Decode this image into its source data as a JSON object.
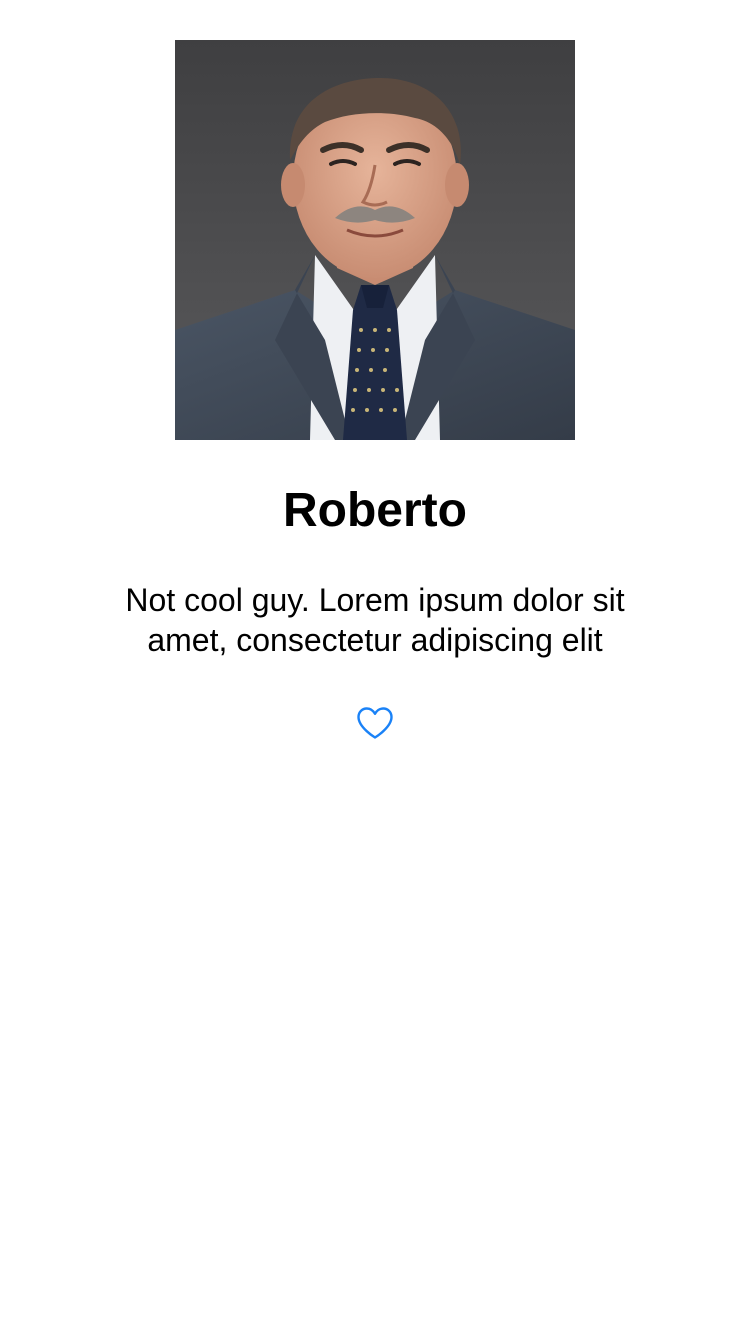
{
  "profile": {
    "name": "Roberto",
    "bio": "Not cool guy. Lorem ipsum dolor sit amet, consectetur adipiscing elit",
    "photo_icon": "person-photo",
    "liked": false
  },
  "actions": {
    "like_icon": "heart-outline-icon"
  },
  "colors": {
    "background": "#ffffff",
    "text": "#000000",
    "accent": "#1a82f7"
  }
}
